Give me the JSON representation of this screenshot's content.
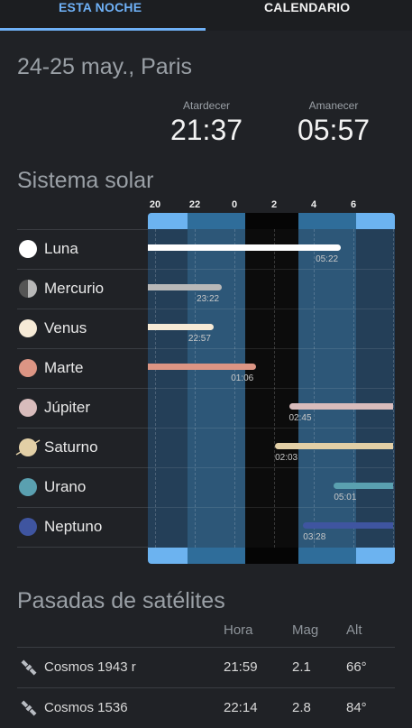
{
  "tabs": [
    {
      "label": "ESTA NOCHE",
      "active": true
    },
    {
      "label": "CALENDARIO",
      "active": false
    }
  ],
  "date_title": "24-25 may., Paris",
  "sunset": {
    "label": "Atardecer",
    "time": "21:37"
  },
  "sunrise": {
    "label": "Amanecer",
    "time": "05:57"
  },
  "solar_system": {
    "title": "Sistema solar",
    "hour_labels": [
      "20",
      "22",
      "0",
      "2",
      "4",
      "6"
    ],
    "planets": [
      {
        "name": "Luna",
        "color": "#ffffff",
        "icon": "moon-full-icon",
        "set_time": "05:22",
        "visible_from": "20:00",
        "visible_to": "05:22"
      },
      {
        "name": "Mercurio",
        "color": "#b8b8b8",
        "icon": "mercury-icon",
        "set_time": "23:22",
        "visible_from": "20:00",
        "visible_to": "23:22"
      },
      {
        "name": "Venus",
        "color": "#f6ead6",
        "icon": "venus-icon",
        "set_time": "22:57",
        "visible_from": "20:00",
        "visible_to": "22:57"
      },
      {
        "name": "Marte",
        "color": "#dc9584",
        "icon": "mars-icon",
        "set_time": "01:06",
        "visible_from": "20:00",
        "visible_to": "01:06"
      },
      {
        "name": "Júpiter",
        "color": "#d8bcbc",
        "icon": "jupiter-icon",
        "set_time": "02:45",
        "visible_from": "02:45",
        "visible_to": "08:00"
      },
      {
        "name": "Saturno",
        "color": "#e2cfa6",
        "icon": "saturn-icon",
        "set_time": "02:03",
        "visible_from": "02:03",
        "visible_to": "08:00"
      },
      {
        "name": "Urano",
        "color": "#5aa0b0",
        "icon": "uranus-icon",
        "set_time": "05:01",
        "visible_from": "05:01",
        "visible_to": "08:00"
      },
      {
        "name": "Neptuno",
        "color": "#3f55a0",
        "icon": "neptune-icon",
        "set_time": "03:28",
        "visible_from": "03:28",
        "visible_to": "08:00"
      }
    ]
  },
  "satellites": {
    "title": "Pasadas de satélites",
    "columns": [
      "Hora",
      "Mag",
      "Alt"
    ],
    "rows": [
      {
        "name": "Cosmos 1943 r",
        "time": "21:59",
        "mag": "2.1",
        "alt": "66°"
      },
      {
        "name": "Cosmos 1536",
        "time": "22:14",
        "mag": "2.8",
        "alt": "84°"
      }
    ]
  },
  "colors": {
    "accent": "#6fb1f7",
    "twilight_light": "#6cb3f0",
    "twilight_mid": "#2d5778",
    "night_blue": "#243f58",
    "night_dark": "#12161c",
    "deep_night": "#0c0c0c"
  }
}
